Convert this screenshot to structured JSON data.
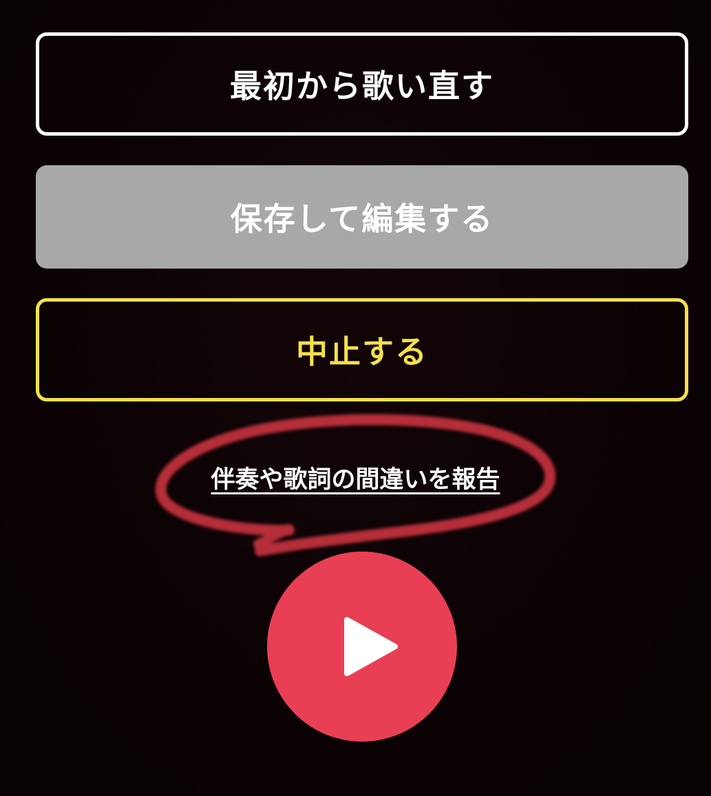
{
  "buttons": {
    "restart_label": "最初から歌い直す",
    "save_edit_label": "保存して編集する",
    "stop_label": "中止する"
  },
  "report": {
    "link_text": "伴奏や歌詞の間違いを報告"
  },
  "player": {
    "play_icon": "play-icon"
  },
  "colors": {
    "background": "#0b0305",
    "restart_border": "#ffffff",
    "save_background": "#a8a8a8",
    "stop_accent": "#f5df4d",
    "play_button": "#e83f54",
    "annotation_stroke": "#c4303d"
  }
}
